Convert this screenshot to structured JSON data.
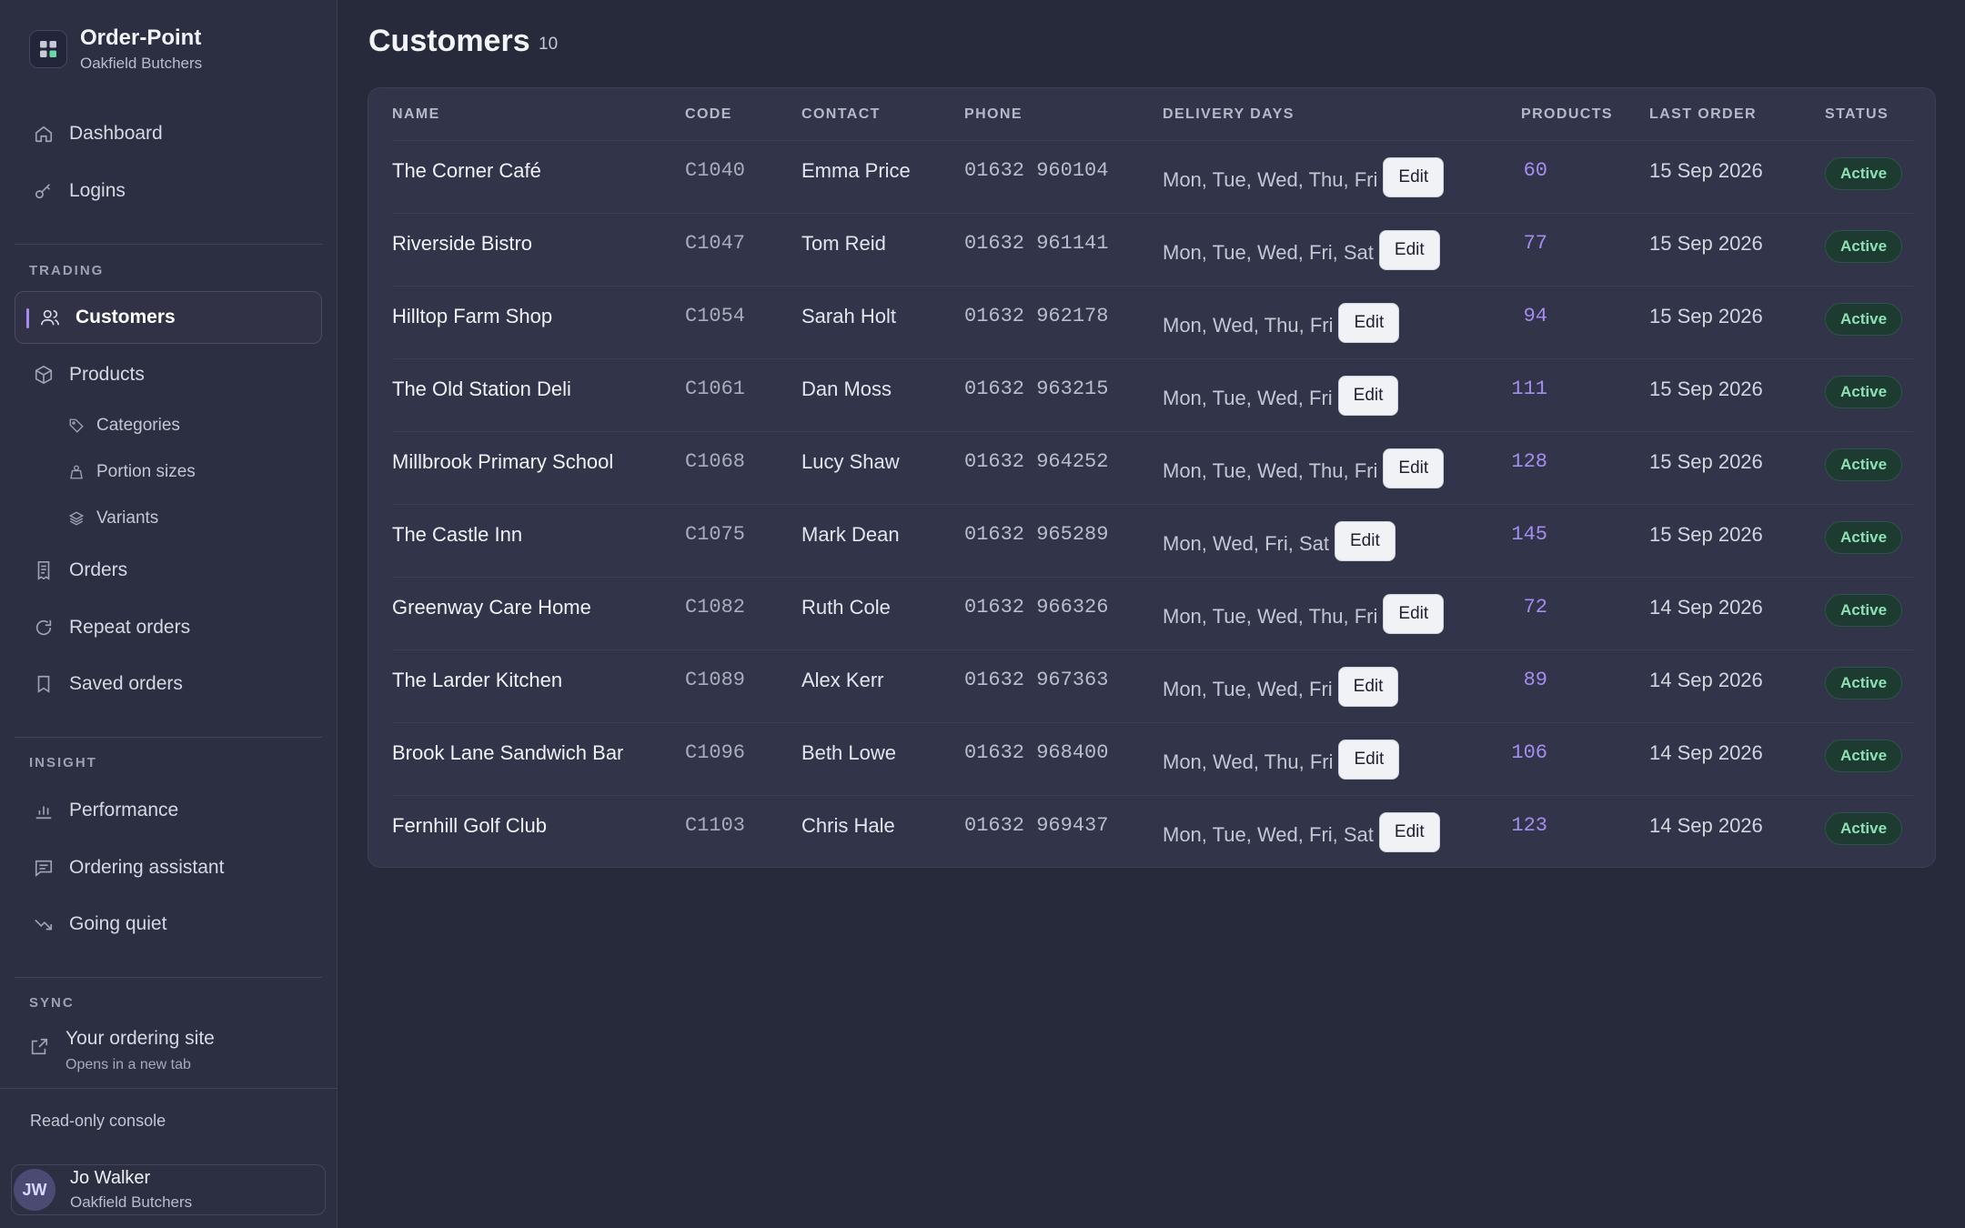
{
  "app": {
    "name": "Order-Point",
    "org": "Oakfield Butchers"
  },
  "sidebar": {
    "top_items": [
      {
        "label": "Dashboard",
        "icon": "home-icon"
      },
      {
        "label": "Logins",
        "icon": "key-icon"
      }
    ],
    "trading_label": "TRADING",
    "trading_items": [
      {
        "label": "Customers",
        "icon": "users-icon",
        "active": true
      },
      {
        "label": "Products",
        "icon": "box-icon"
      }
    ],
    "product_subitems": [
      {
        "label": "Categories",
        "icon": "tag-icon"
      },
      {
        "label": "Portion sizes",
        "icon": "weight-icon"
      },
      {
        "label": "Variants",
        "icon": "layers-icon"
      }
    ],
    "order_items": [
      {
        "label": "Orders",
        "icon": "receipt-icon"
      },
      {
        "label": "Repeat orders",
        "icon": "repeat-icon"
      },
      {
        "label": "Saved orders",
        "icon": "bookmark-icon"
      }
    ],
    "insight_label": "INSIGHT",
    "insight_items": [
      {
        "label": "Performance",
        "icon": "bar-chart-icon"
      },
      {
        "label": "Ordering assistant",
        "icon": "chat-icon"
      },
      {
        "label": "Going quiet",
        "icon": "trend-down-icon"
      }
    ],
    "sync_label": "SYNC",
    "external": {
      "title": "Your ordering site",
      "subtitle": "Opens in a new tab",
      "icon": "external-link-icon"
    },
    "readonly_note": "Read-only console",
    "user": {
      "initials": "JW",
      "name": "Jo Walker",
      "org": "Oakfield Butchers"
    }
  },
  "main": {
    "title": "Customers",
    "count": "10",
    "columns": [
      "NAME",
      "CODE",
      "CONTACT",
      "PHONE",
      "DELIVERY DAYS",
      "PRODUCTS",
      "LAST ORDER",
      "STATUS"
    ],
    "edit_label": "Edit",
    "rows": [
      {
        "name": "The Corner Café",
        "code": "C1040",
        "contact": "Emma Price",
        "phone": "01632 960104",
        "days": "Mon, Tue, Wed, Thu, Fri",
        "products": "60",
        "last_order": "15 Sep 2026",
        "status": "Active"
      },
      {
        "name": "Riverside Bistro",
        "code": "C1047",
        "contact": "Tom Reid",
        "phone": "01632 961141",
        "days": "Mon, Tue, Wed, Fri, Sat",
        "products": "77",
        "last_order": "15 Sep 2026",
        "status": "Active"
      },
      {
        "name": "Hilltop Farm Shop",
        "code": "C1054",
        "contact": "Sarah Holt",
        "phone": "01632 962178",
        "days": "Mon, Wed, Thu, Fri",
        "products": "94",
        "last_order": "15 Sep 2026",
        "status": "Active"
      },
      {
        "name": "The Old Station Deli",
        "code": "C1061",
        "contact": "Dan Moss",
        "phone": "01632 963215",
        "days": "Mon, Tue, Wed, Fri",
        "products": "111",
        "last_order": "15 Sep 2026",
        "status": "Active"
      },
      {
        "name": "Millbrook Primary School",
        "code": "C1068",
        "contact": "Lucy Shaw",
        "phone": "01632 964252",
        "days": "Mon, Tue, Wed, Thu, Fri",
        "products": "128",
        "last_order": "15 Sep 2026",
        "status": "Active"
      },
      {
        "name": "The Castle Inn",
        "code": "C1075",
        "contact": "Mark Dean",
        "phone": "01632 965289",
        "days": "Mon, Wed, Fri, Sat",
        "products": "145",
        "last_order": "15 Sep 2026",
        "status": "Active"
      },
      {
        "name": "Greenway Care Home",
        "code": "C1082",
        "contact": "Ruth Cole",
        "phone": "01632 966326",
        "days": "Mon, Tue, Wed, Thu, Fri",
        "products": "72",
        "last_order": "14 Sep 2026",
        "status": "Active"
      },
      {
        "name": "The Larder Kitchen",
        "code": "C1089",
        "contact": "Alex Kerr",
        "phone": "01632 967363",
        "days": "Mon, Tue, Wed, Fri",
        "products": "89",
        "last_order": "14 Sep 2026",
        "status": "Active"
      },
      {
        "name": "Brook Lane Sandwich Bar",
        "code": "C1096",
        "contact": "Beth Lowe",
        "phone": "01632 968400",
        "days": "Mon, Wed, Thu, Fri",
        "products": "106",
        "last_order": "14 Sep 2026",
        "status": "Active"
      },
      {
        "name": "Fernhill Golf Club",
        "code": "C1103",
        "contact": "Chris Hale",
        "phone": "01632 969437",
        "days": "Mon, Tue, Wed, Fri, Sat",
        "products": "123",
        "last_order": "14 Sep 2026",
        "status": "Active"
      }
    ]
  },
  "colors": {
    "background": "#272a3b",
    "sidebar": "#2c2f42",
    "accent": "#a48cf0",
    "active_badge_bg": "#1e3b32",
    "active_badge_text": "#8ee0b4"
  }
}
